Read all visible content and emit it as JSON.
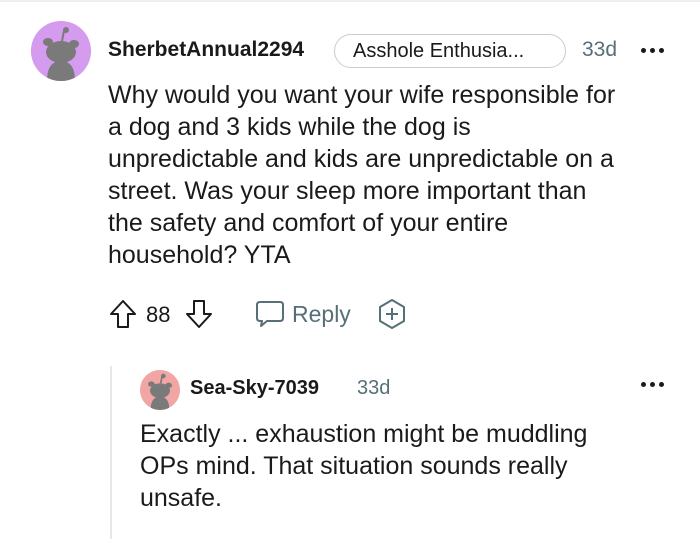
{
  "comment": {
    "author": "SherbetAnnual2294",
    "flair": "Asshole Enthusia...",
    "age": "33d",
    "body_lines": [
      "Why would you want your wife responsible for",
      "a dog and 3 kids while the dog is",
      "unpredictable and kids are unpredictable on a",
      "street. Was your sleep more important than",
      "the safety and comfort of your entire",
      "household? YTA"
    ],
    "votes": "88",
    "reply_label": "Reply",
    "avatar_color": "#d59bee"
  },
  "reply": {
    "author": "Sea-Sky-7039",
    "age": "33d",
    "body_lines": [
      "Exactly ... exhaustion might be muddling",
      "OPs mind. That situation sounds really",
      "unsafe."
    ],
    "avatar_color": "#f2a5a5"
  },
  "icons": {
    "avatar": "snoo-avatar-icon",
    "upvote": "arrow-up-icon",
    "downvote": "arrow-down-icon",
    "reply": "speech-bubble-icon",
    "award": "award-plus-icon",
    "more": "ellipsis-icon"
  },
  "colors": {
    "text": "#1a1a1b",
    "meta": "#576f76",
    "border": "#c9ccce",
    "thread_line": "#e5e7e9"
  }
}
